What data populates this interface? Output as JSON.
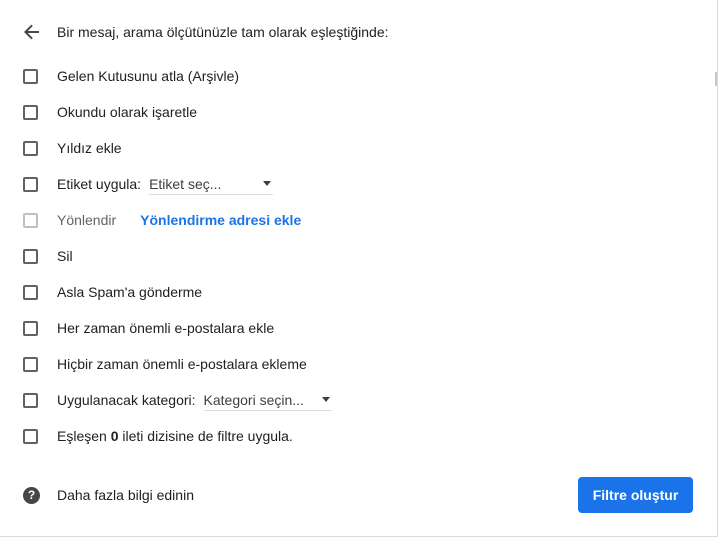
{
  "header": {
    "back_icon": "arrow-back-icon",
    "title": "Bir mesaj, arama ölçütünüzle tam olarak eşleştiğinde:"
  },
  "options": {
    "skip_inbox": "Gelen Kutusunu atla (Arşivle)",
    "mark_read": "Okundu olarak işaretle",
    "star": "Yıldız ekle",
    "apply_label": "Etiket uygula:",
    "label_select": "Etiket seç...",
    "forward": "Yönlendir",
    "forward_link": "Yönlendirme adresi ekle",
    "delete": "Sil",
    "never_spam": "Asla Spam'a gönderme",
    "always_important": "Her zaman önemli e-postalara ekle",
    "never_important": "Hiçbir zaman önemli e-postalara ekleme",
    "categorize": "Uygulanacak kategori:",
    "category_select": "Kategori seçin...",
    "also_apply_prefix": "Eşleşen",
    "also_apply_count": "0",
    "also_apply_suffix": "ileti dizisine de filtre uygula."
  },
  "footer": {
    "help_icon": "help-icon",
    "help_text": "Daha fazla bilgi edinin",
    "create_button": "Filtre oluştur"
  },
  "colors": {
    "accent": "#1a73e8",
    "text": "#202124",
    "checkbox_border": "#5f6368",
    "checkbox_disabled": "#bdc1c6"
  }
}
